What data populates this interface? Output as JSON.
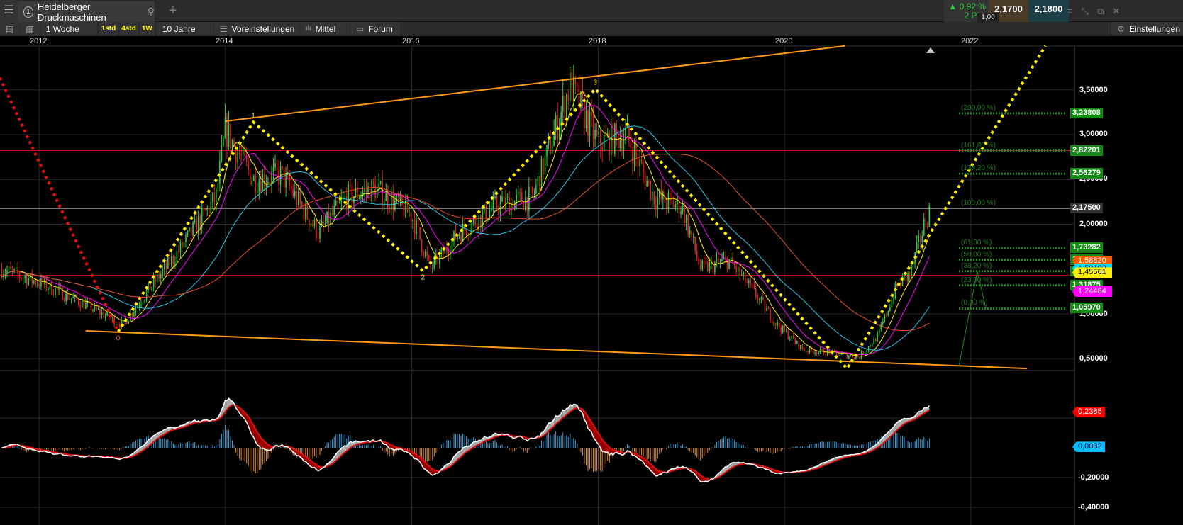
{
  "window": {
    "tab_number": "1",
    "tab_title": "Heidelberger Druckmaschinen",
    "change_pct": "▲ 0,92 %",
    "change_pts": "2 Pkt.",
    "bid": "2,1700",
    "ask": "2,1800",
    "spread": "1,00"
  },
  "toolbar": {
    "interval": "1 Woche",
    "quick": [
      "1std",
      "4std",
      "1W"
    ],
    "range": "10 Jahre",
    "presets": "Voreinstellungen",
    "indicator": "Mittel",
    "forum": "Forum",
    "settings": "Einstellungen"
  },
  "time_axis": [
    "2012",
    "2014",
    "2016",
    "2018",
    "2020",
    "2022"
  ],
  "price_axis": [
    "3,50000",
    "3,00000",
    "2,50000",
    "2,00000",
    "1,00000",
    "0,50000"
  ],
  "indicator_axis": [
    "-0,20000",
    "-0,40000"
  ],
  "fib_levels": [
    {
      "pct": "(200,00 %)",
      "value": "3,23808",
      "price": 3.23808
    },
    {
      "pct": "(161,80 %)",
      "value": "2,82201",
      "price": 2.82201
    },
    {
      "pct": "(138,20 %)",
      "value": "2,56279",
      "price": 2.56279
    },
    {
      "pct": "(100,00 %)",
      "value": "2,17500",
      "price": 2.175
    },
    {
      "pct": "(61,80 %)",
      "value": "1,73282",
      "price": 1.73282
    },
    {
      "pct": "(50,00 %)",
      "value": "1,58820",
      "price": 1.6043
    },
    {
      "pct": "(38,20 %)",
      "value": "1,50193",
      "price": 1.4758
    },
    {
      "pct": "(23,60 %)",
      "value": "1,31875",
      "price": 1.31875
    },
    {
      "pct": "(0,00 %)",
      "value": "1,05970",
      "price": 1.0597
    }
  ],
  "ma_tags": [
    {
      "value": "1,58820",
      "color": "#ff5a00",
      "price": 1.5882
    },
    {
      "value": "1,50193",
      "color": "#00d8ff",
      "price": 1.50193
    },
    {
      "value": "1,45561",
      "color": "#ffee00",
      "price": 1.4556
    },
    {
      "value": "1,24484",
      "color": "#ff00ff",
      "price": 1.24484
    }
  ],
  "indicator_tags": [
    {
      "value": "0,2385",
      "color": "#ff0000",
      "level": 0.2385
    },
    {
      "value": "0,0032",
      "color": "#00bfff",
      "level": 0.0032
    }
  ],
  "wave_labels": [
    "0",
    "1",
    "2",
    "3"
  ],
  "chart_data": {
    "type": "candlestick",
    "title": "Heidelberger Druckmaschinen",
    "interval": "weekly",
    "keyframes": [
      [
        2011.6,
        1.5
      ],
      [
        2012.0,
        1.35
      ],
      [
        2012.5,
        1.1
      ],
      [
        2012.9,
        0.88
      ],
      [
        2013.2,
        1.3
      ],
      [
        2013.5,
        1.7
      ],
      [
        2013.9,
        2.3
      ],
      [
        2014.0,
        3.05
      ],
      [
        2014.3,
        2.5
      ],
      [
        2014.6,
        2.55
      ],
      [
        2015.0,
        1.9
      ],
      [
        2015.3,
        2.3
      ],
      [
        2015.6,
        2.4
      ],
      [
        2016.0,
        2.1
      ],
      [
        2016.2,
        1.5
      ],
      [
        2016.5,
        1.9
      ],
      [
        2016.9,
        2.2
      ],
      [
        2017.3,
        2.3
      ],
      [
        2017.7,
        3.55
      ],
      [
        2018.0,
        2.9
      ],
      [
        2018.3,
        3.0
      ],
      [
        2018.6,
        2.3
      ],
      [
        2018.9,
        2.2
      ],
      [
        2019.1,
        1.5
      ],
      [
        2019.4,
        1.6
      ],
      [
        2019.7,
        1.2
      ],
      [
        2019.9,
        0.9
      ],
      [
        2020.2,
        0.6
      ],
      [
        2020.6,
        0.55
      ],
      [
        2020.8,
        0.52
      ],
      [
        2021.0,
        0.75
      ],
      [
        2021.2,
        1.3
      ],
      [
        2021.35,
        1.45
      ],
      [
        2021.5,
        2.0
      ],
      [
        2021.56,
        2.175
      ]
    ],
    "trendlines": [
      {
        "color": "#ff9a1a",
        "from": [
          2014.0,
          3.15
        ],
        "to": [
          2020.65,
          3.99
        ]
      },
      {
        "color": "#ff9a1a",
        "from": [
          2012.5,
          0.81
        ],
        "to": [
          2022.6,
          0.39
        ]
      }
    ],
    "horizontal_lines": [
      {
        "color": "#d01010",
        "price": 2.822
      },
      {
        "color": "#d01010",
        "price": 1.43
      },
      {
        "color": "#888",
        "price": 2.175
      }
    ],
    "wave_points": [
      [
        2012.85,
        0.8
      ],
      [
        2014.3,
        3.14
      ],
      [
        2016.12,
        1.48
      ],
      [
        2017.97,
        3.51
      ],
      [
        2020.67,
        0.39
      ],
      [
        2022.8,
        3.99
      ]
    ],
    "red_dotted": [
      [
        2011.55,
        3.7
      ],
      [
        2012.85,
        0.8
      ]
    ],
    "yaxis": [
      0.4,
      3.9
    ],
    "xaxis": [
      2011.58,
      2023.0
    ]
  }
}
